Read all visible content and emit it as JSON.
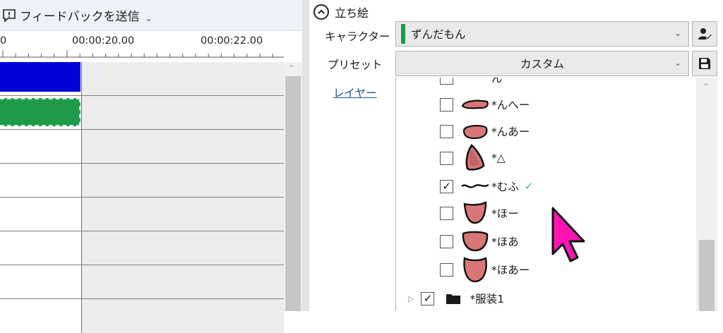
{
  "feedback": {
    "label": "フィードバックを送信"
  },
  "timeline": {
    "ticks": [
      "0",
      "00:00:20.00",
      "00:00:22.00"
    ]
  },
  "panel": {
    "section_title": "立ち絵",
    "character_label": "キャラクター",
    "character_value": "ずんだもん",
    "preset_label": "プリセット",
    "preset_value": "カスタム",
    "layer_label": "レイヤー"
  },
  "layers": [
    {
      "name": "ん",
      "checked": false
    },
    {
      "name": "*んへー",
      "checked": false
    },
    {
      "name": "*んあー",
      "checked": false
    },
    {
      "name": "*△",
      "checked": false
    },
    {
      "name": "*むふ",
      "checked": true
    },
    {
      "name": "*ほー",
      "checked": false
    },
    {
      "name": "*ほあ",
      "checked": false
    },
    {
      "name": "*ほあー",
      "checked": false
    }
  ],
  "folder": {
    "name": "*服装1",
    "checked": true
  },
  "colors": {
    "character_accent": "#1e9a4a",
    "clip_blue": "#0000d8",
    "clip_green": "#1e9a4a",
    "cursor": "#ff14b4"
  }
}
